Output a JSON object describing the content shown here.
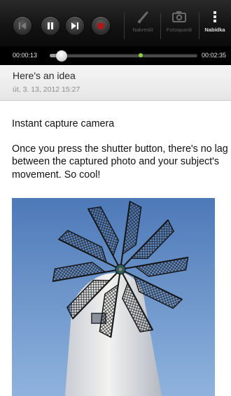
{
  "toolbar": {
    "playback_buttons": [
      "previous-icon",
      "pause-icon",
      "next-icon",
      "record-icon"
    ],
    "draw_label": "Nakreslit",
    "photo_label": "Fotoaparát",
    "menu_label": "Nabídka",
    "colors": {
      "background": "#121212",
      "record": "#b01818",
      "inactive_label": "#5d5d5d",
      "active_label": "#dcdcdc"
    }
  },
  "playback": {
    "elapsed": "00:00:13",
    "total": "00:02:35",
    "progress_fraction": 0.08,
    "marker_fraction": 0.6,
    "marker_color": "#8fd23c"
  },
  "note": {
    "title": "Here's an idea",
    "date": "út, 3. 13, 2012 15:27",
    "heading": "Instant capture camera",
    "paragraph": "Once you press the shutter button, there's no lag between the captured photo and your subject's movement. So cool!",
    "image_icon": "windmill-photo"
  }
}
